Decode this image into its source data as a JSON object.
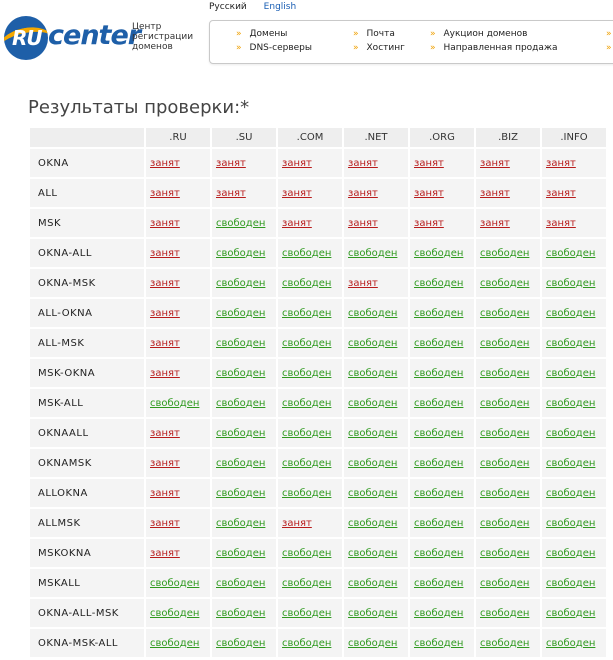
{
  "lang": {
    "ru": "Русский",
    "en": "English"
  },
  "logo": {
    "ru": "RU",
    "center": "center",
    "sub1": "Центр",
    "sub2": "регистрации",
    "sub3": "доменов"
  },
  "nav": {
    "col1": [
      "Домены",
      "DNS-серверы"
    ],
    "col2": [
      "Почта",
      "Хостинг"
    ],
    "col3": [
      "Аукцион доменов",
      "Направленная продажа"
    ]
  },
  "title": "Результаты проверки:*",
  "table": {
    "headers": [
      ".RU",
      ".SU",
      ".COM",
      ".NET",
      ".ORG",
      ".BIZ",
      ".INFO"
    ],
    "busy_label": "занят",
    "free_label": "свободен",
    "rows": [
      {
        "name": "OKNA",
        "status": [
          "b",
          "b",
          "b",
          "b",
          "b",
          "b",
          "b"
        ]
      },
      {
        "name": "ALL",
        "status": [
          "b",
          "b",
          "b",
          "b",
          "b",
          "b",
          "b"
        ]
      },
      {
        "name": "MSK",
        "status": [
          "b",
          "f",
          "b",
          "b",
          "b",
          "b",
          "b"
        ]
      },
      {
        "name": "OKNA-ALL",
        "status": [
          "b",
          "f",
          "f",
          "f",
          "f",
          "f",
          "f"
        ]
      },
      {
        "name": "OKNA-MSK",
        "status": [
          "b",
          "f",
          "f",
          "b",
          "f",
          "f",
          "f"
        ]
      },
      {
        "name": "ALL-OKNA",
        "status": [
          "b",
          "f",
          "f",
          "f",
          "f",
          "f",
          "f"
        ]
      },
      {
        "name": "ALL-MSK",
        "status": [
          "b",
          "f",
          "f",
          "f",
          "f",
          "f",
          "f"
        ]
      },
      {
        "name": "MSK-OKNA",
        "status": [
          "b",
          "f",
          "f",
          "f",
          "f",
          "f",
          "f"
        ]
      },
      {
        "name": "MSK-ALL",
        "status": [
          "f",
          "f",
          "f",
          "f",
          "f",
          "f",
          "f"
        ]
      },
      {
        "name": "OKNAALL",
        "status": [
          "b",
          "f",
          "f",
          "f",
          "f",
          "f",
          "f"
        ]
      },
      {
        "name": "OKNAMSK",
        "status": [
          "b",
          "f",
          "f",
          "f",
          "f",
          "f",
          "f"
        ]
      },
      {
        "name": "ALLOKNA",
        "status": [
          "b",
          "f",
          "f",
          "f",
          "f",
          "f",
          "f"
        ]
      },
      {
        "name": "ALLMSK",
        "status": [
          "b",
          "f",
          "b",
          "f",
          "f",
          "f",
          "f"
        ]
      },
      {
        "name": "MSKOKNA",
        "status": [
          "b",
          "f",
          "f",
          "f",
          "f",
          "f",
          "f"
        ]
      },
      {
        "name": "MSKALL",
        "status": [
          "f",
          "f",
          "f",
          "f",
          "f",
          "f",
          "f"
        ]
      },
      {
        "name": "OKNA-ALL-MSK",
        "status": [
          "f",
          "f",
          "f",
          "f",
          "f",
          "f",
          "f"
        ]
      },
      {
        "name": "OKNA-MSK-ALL",
        "status": [
          "f",
          "f",
          "f",
          "f",
          "f",
          "f",
          "f"
        ]
      }
    ]
  },
  "colors": {
    "busy": "#b81c1c",
    "free": "#2e9a1e",
    "brand": "#1e5fa8",
    "accent": "#f5a800"
  }
}
